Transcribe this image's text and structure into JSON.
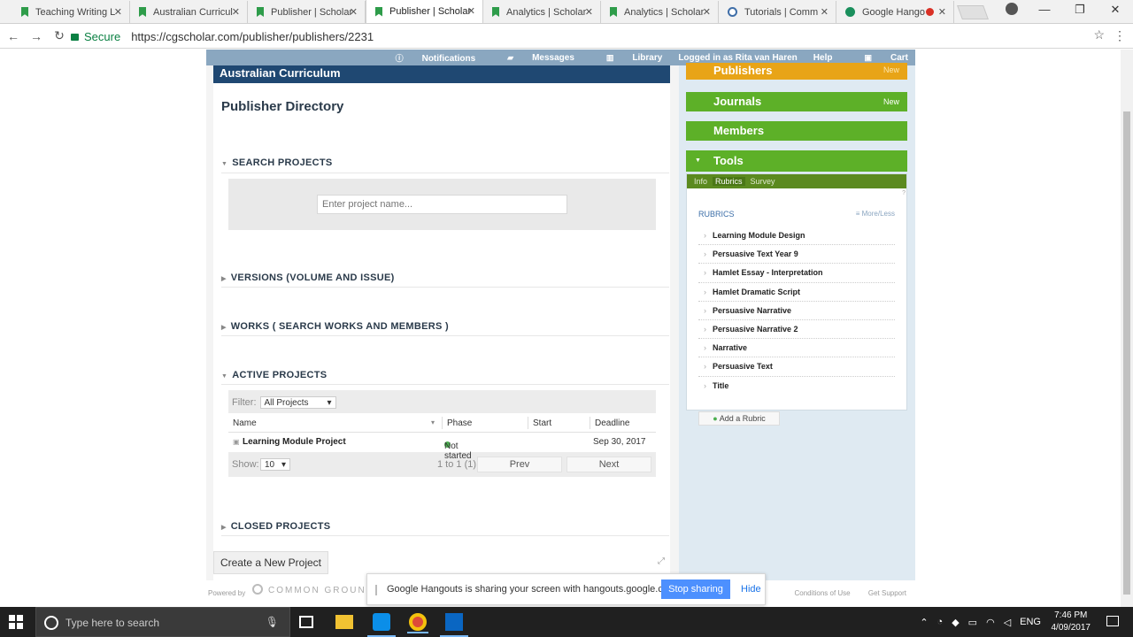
{
  "browser": {
    "tabs": [
      {
        "label": "Teaching Writing L",
        "active": false
      },
      {
        "label": "Australian Curricul",
        "active": false
      },
      {
        "label": "Publisher | Scholar",
        "active": false
      },
      {
        "label": "Publisher | Scholar",
        "active": true
      },
      {
        "label": "Analytics | Scholar",
        "active": false
      },
      {
        "label": "Analytics | Scholar",
        "active": false
      },
      {
        "label": "Tutorials | Comm",
        "active": false
      },
      {
        "label": "Google Hango",
        "active": false
      }
    ],
    "secure_label": "Secure",
    "url": "https://cgscholar.com/publisher/publishers/2231"
  },
  "topnav": {
    "notifications": "Notifications",
    "messages": "Messages",
    "library": "Library",
    "logged_in": "Logged in as Rita van Haren",
    "help": "Help",
    "cart": "Cart"
  },
  "main": {
    "banner": "Australian Curriculum",
    "title": "Publisher Directory",
    "sections": {
      "search": "SEARCH PROJECTS",
      "versions": "VERSIONS (VOLUME AND ISSUE)",
      "works": "WORKS ( SEARCH WORKS AND MEMBERS )",
      "active": "ACTIVE PROJECTS",
      "closed": "CLOSED PROJECTS"
    },
    "search_placeholder": "Enter project name...",
    "table": {
      "filter_label": "Filter:",
      "filter_value": "All Projects",
      "columns": {
        "name": "Name",
        "phase": "Phase",
        "start": "Start",
        "deadline": "Deadline"
      },
      "rows": [
        {
          "name": "Learning Module Project",
          "phase": "Not started",
          "start": "",
          "deadline": "Sep 30, 2017"
        }
      ],
      "show_label": "Show:",
      "show_value": "10",
      "range": "1 to 1 (1)",
      "prev": "Prev",
      "next": "Next"
    },
    "create_button": "Create a New Project"
  },
  "sidebar": {
    "publishers": {
      "label": "Publishers",
      "badge": "New",
      "color": "#e8a417"
    },
    "journals": {
      "label": "Journals",
      "badge": "New",
      "color": "#5db028"
    },
    "members": {
      "label": "Members",
      "color": "#5db028"
    },
    "tools": {
      "label": "Tools",
      "color": "#5db028"
    },
    "subtabs": [
      "Info",
      "Rubrics",
      "Survey"
    ],
    "rubrics_heading": "RUBRICS",
    "more_less": "More/Less",
    "rubrics": [
      "Learning Module Design",
      "Persuasive Text Year 9",
      "Hamlet Essay - Interpretation",
      "Hamlet Dramatic Script",
      "Persuasive Narrative",
      "Persuasive Narrative 2",
      "Narrative",
      "Persuasive Text",
      "Title"
    ],
    "add_rubric": "Add a Rubric"
  },
  "footer": {
    "powered_by": "Powered by",
    "brand": "COMMON GROUND",
    "conditions": "Conditions of Use",
    "support": "Get Support"
  },
  "sharebar": {
    "message": "Google Hangouts is sharing your screen with hangouts.google.com.",
    "stop": "Stop sharing",
    "hide": "Hide"
  },
  "taskbar": {
    "search_placeholder": "Type here to search",
    "language": "ENG",
    "time": "7:46 PM",
    "date": "4/09/2017"
  }
}
